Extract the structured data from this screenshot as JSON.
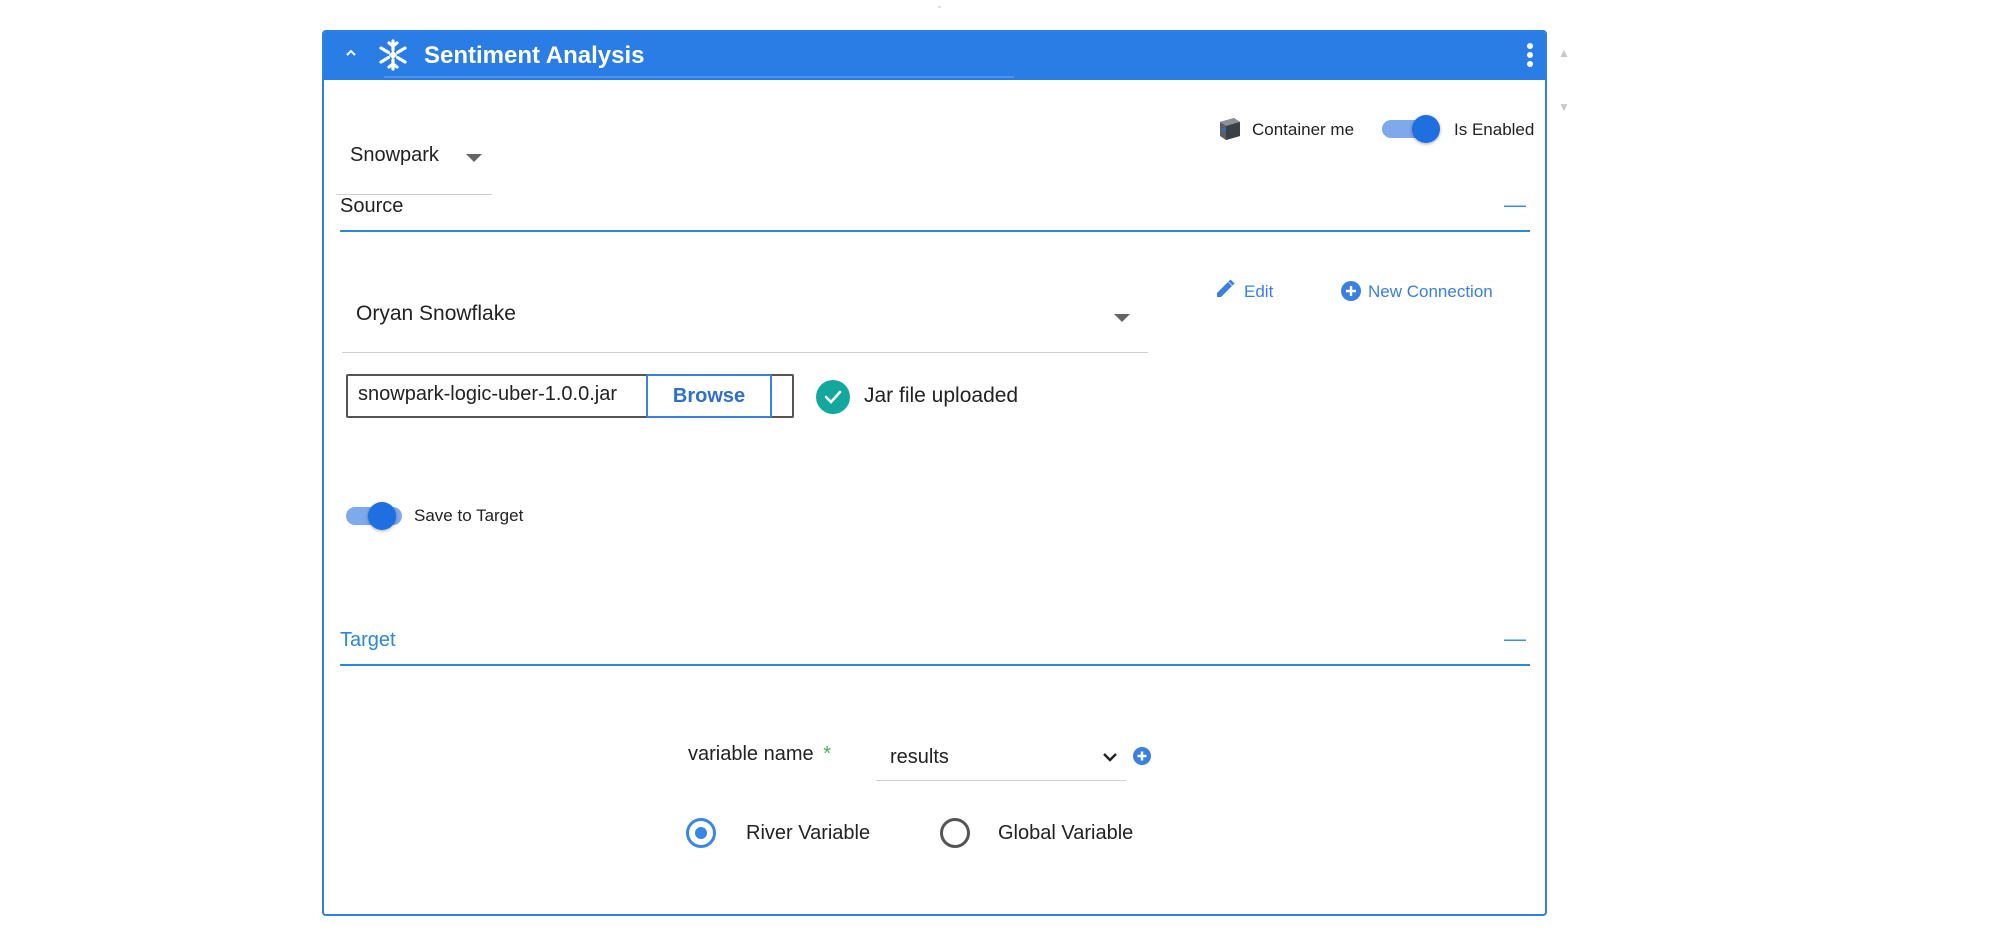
{
  "header": {
    "title": "Sentiment Analysis",
    "collapse_icon": "chevron-up-icon",
    "logo_icon": "snowflake-icon",
    "menu_icon": "vertical-dots-icon",
    "bg_color": "#2a7de5"
  },
  "top_row": {
    "mode_select": "Snowpark",
    "container_label": "Container me",
    "enabled_label": "Is Enabled",
    "enabled": true
  },
  "source": {
    "title": "Source",
    "collapse_symbol": "—",
    "connection": "Oryan Snowflake",
    "edit_label": "Edit",
    "new_connection_label": "New Connection",
    "file_name": "snowpark-logic-uber-1.0.0.jar",
    "browse_label": "Browse",
    "upload_status": "Jar file uploaded",
    "save_to_target_label": "Save to Target",
    "save_to_target": true
  },
  "target": {
    "title": "Target",
    "collapse_symbol": "—",
    "variable_name_label": "variable name",
    "required_mark": "*",
    "variable_value": "results",
    "radio_options": [
      {
        "label": "River Variable",
        "selected": true
      },
      {
        "label": "Global Variable",
        "selected": false
      }
    ]
  },
  "colors": {
    "accent": "#2a7de5",
    "success": "#13a89e",
    "required": "#4caf50"
  }
}
